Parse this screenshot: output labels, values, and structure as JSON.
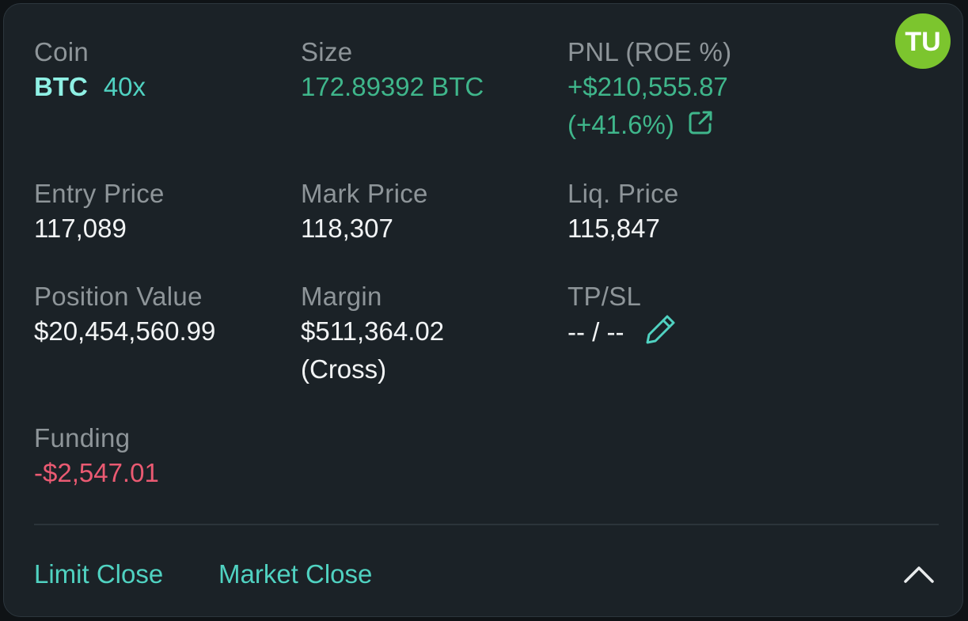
{
  "logo": {
    "text": "TU",
    "color": "#7cc52e"
  },
  "coin": {
    "label": "Coin",
    "symbol": "BTC",
    "leverage": "40x"
  },
  "size": {
    "label": "Size",
    "value": "172.89392 BTC"
  },
  "pnl": {
    "label": "PNL (ROE %)",
    "value": "+$210,555.87",
    "roe": "(+41.6%)",
    "share_icon": "external-link-icon"
  },
  "entry_price": {
    "label": "Entry Price",
    "value": "117,089"
  },
  "mark_price": {
    "label": "Mark Price",
    "value": "118,307"
  },
  "liq_price": {
    "label": "Liq. Price",
    "value": "115,847"
  },
  "position_value": {
    "label": "Position Value",
    "value": "$20,454,560.99"
  },
  "margin": {
    "label": "Margin",
    "value": "$511,364.02",
    "mode": "(Cross)"
  },
  "tpsl": {
    "label": "TP/SL",
    "value": "-- / --",
    "edit_icon": "pencil-icon"
  },
  "funding": {
    "label": "Funding",
    "value": "-$2,547.01"
  },
  "actions": {
    "limit_close": "Limit Close",
    "market_close": "Market Close",
    "collapse_icon": "chevron-up-icon"
  },
  "colors": {
    "background": "#1b2227",
    "positive": "#3fb68b",
    "accent": "#50d2c1",
    "negative": "#ea5a72",
    "label": "#8e9599",
    "value": "#f2f4f5"
  }
}
